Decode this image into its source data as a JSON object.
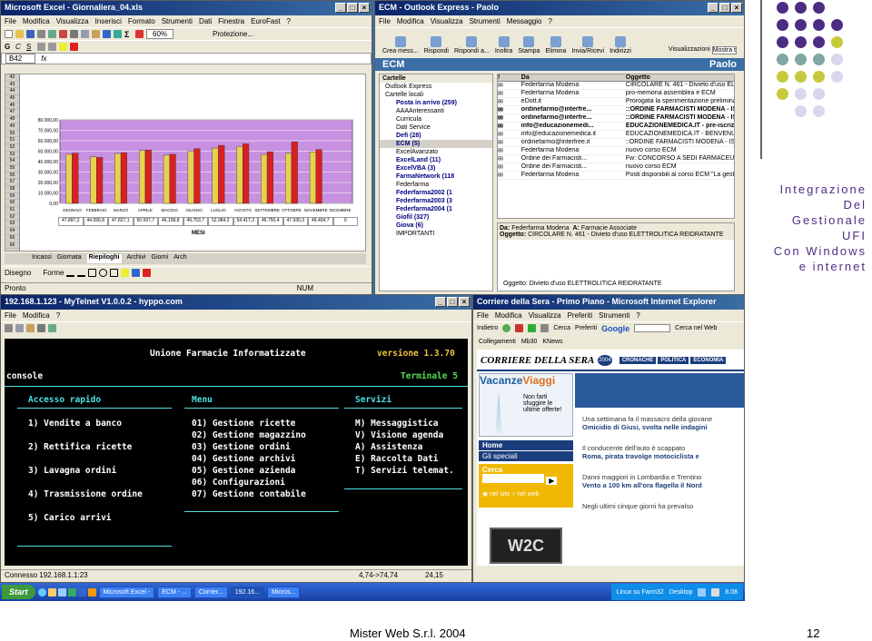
{
  "slide": {
    "title_lines": [
      "Integrazione",
      "Del",
      "Gestionale",
      "UFI",
      "Con Windows",
      "e internet"
    ],
    "footer_left": "Mister Web S.r.l. 2004",
    "footer_right": "12",
    "accent_colors": {
      "purple": "#4b2e83",
      "teal": "#7fa7a4",
      "lime": "#c6c93c",
      "lavender": "#d8d8ec"
    }
  },
  "excel": {
    "title": "Microsoft Excel - Giornaliera_04.xls",
    "menu": [
      "File",
      "Modifica",
      "Visualizza",
      "Inserisci",
      "Formato",
      "Strumenti",
      "Dati",
      "Finestra",
      "EuroFast",
      "?"
    ],
    "zoom": "60%",
    "protection": "Protezione...",
    "cell_ref": "B42",
    "fx": "fx",
    "sheet_tabs": [
      "Incassi",
      "Giornata",
      "Riepiloghi",
      "Archivi",
      "Giorni",
      "Arch"
    ],
    "active_tab": "Riepiloghi",
    "drawing_label": "Disegno",
    "shapes_label": "Forme",
    "status_left": "Pronto",
    "status_right": "NUM",
    "axis_label": "MESI",
    "months": [
      "GENNAIO",
      "FEBBRAIO",
      "MARZO",
      "APRILE",
      "MAGGIO",
      "GIUGNO",
      "LUGLIO",
      "AGOSTO",
      "SETTEMBRE",
      "OTTOBRE",
      "NOVEMBRE",
      "DICEMBRE"
    ],
    "y_ticks": [
      "80.000,00",
      "70.000,00",
      "60.000,00",
      "50.000,00",
      "40.000,00",
      "30.000,00",
      "20.000,00",
      "10.000,00",
      "0,00"
    ],
    "row_values": [
      "47.897,2",
      "44.590,8",
      "47.827,1",
      "50.597,7",
      "46.158,8",
      "49.753,7",
      "52.984,2",
      "54.417,3",
      "46.750,4",
      "47.930,3",
      "49.404,7",
      "0"
    ]
  },
  "chart_data": {
    "type": "bar",
    "categories": [
      "GENNAIO",
      "FEBBRAIO",
      "MARZO",
      "APRILE",
      "MAGGIO",
      "GIUGNO",
      "LUGLIO",
      "AGOSTO",
      "SETTEMBRE",
      "OTTOBRE",
      "NOVEMBRE",
      "DICEMBRE"
    ],
    "series": [
      {
        "values": [
          47000,
          44600,
          47800,
          50600,
          46200,
          49800,
          53000,
          54400,
          46800,
          47900,
          49400,
          0
        ]
      },
      {
        "values": [
          48000,
          44000,
          48500,
          51200,
          47000,
          52300,
          55600,
          57000,
          49500,
          59000,
          51500,
          0
        ]
      }
    ],
    "colors": [
      "#e8d050",
      "#d92020"
    ],
    "xlabel": "MESI",
    "ylim": [
      0,
      80000
    ],
    "background": "#c890e0"
  },
  "outlook": {
    "title": "ECM - Outlook Express - Paolo",
    "menu": [
      "File",
      "Modifica",
      "Visualizza",
      "Strumenti",
      "Messaggio",
      "?"
    ],
    "toolbar": [
      "Crea mess...",
      "Rispondi",
      "Rispondi a...",
      "Inoltra",
      "Stampa",
      "Elimina",
      "Invia/Ricevi",
      "Indirizzi"
    ],
    "view_label": "Visualizzazioni",
    "view_value": "Mostra t",
    "folder_header": "ECM",
    "user_header": "Paolo",
    "folders_caption": "Cartelle",
    "folders": [
      {
        "name": "Outlook Express",
        "bold": false
      },
      {
        "name": "Cartelle locali",
        "bold": false
      },
      {
        "name": "Posta in arrivo (259)",
        "bold": true
      },
      {
        "name": "AAAAnteressanti",
        "bold": false
      },
      {
        "name": "Curricula",
        "bold": false
      },
      {
        "name": "Dati Service",
        "bold": false
      },
      {
        "name": "Defi (28)",
        "bold": true
      },
      {
        "name": "ECM (5)",
        "bold": true
      },
      {
        "name": "ExcelAvanzato",
        "bold": false
      },
      {
        "name": "ExcelLand (11)",
        "bold": true
      },
      {
        "name": "ExcelVBA (3)",
        "bold": true
      },
      {
        "name": "FarmaNetwork (118",
        "bold": true
      },
      {
        "name": "Federfarma",
        "bold": false
      },
      {
        "name": "Federfarma2002 (1",
        "bold": true
      },
      {
        "name": "Federfarma2003 (3",
        "bold": true
      },
      {
        "name": "Federfarma2004 (1",
        "bold": true
      },
      {
        "name": "Giofil (327)",
        "bold": true
      },
      {
        "name": "Giova (6)",
        "bold": true
      },
      {
        "name": "IMPORTANTI",
        "bold": false
      }
    ],
    "columns": {
      "from": "Da",
      "subject": "Oggetto"
    },
    "messages": [
      {
        "from": "Federfarma Modena",
        "subject": "CIRCOLARE N. 461 - Divieto d'uso ELETTRA",
        "bold": false
      },
      {
        "from": "Federfarma Modena",
        "subject": "pro-memoria assemblea e ECM",
        "bold": false
      },
      {
        "from": "eDott.it",
        "subject": "Prorogata la sperimentazione preliminare p",
        "bold": false
      },
      {
        "from": "ordinefarmo@interfre...",
        "subject": "::ORDINE FARMACISTI MODENA - ISCR",
        "bold": true
      },
      {
        "from": "ordinefarmo@interfre...",
        "subject": "::ORDINE FARMACISTI MODENA - ISCR",
        "bold": true
      },
      {
        "from": "info@educazionemedi...",
        "subject": "EDUCAZIONEMEDICA.IT - pre-iscrizio",
        "bold": true
      },
      {
        "from": "info@educazionemedica.it",
        "subject": "EDUCAZIONEMEDICA.IT - BENVENUTO!",
        "bold": false
      },
      {
        "from": "ordinefarmo@interfree.it",
        "subject": "::ORDINE FARMACISTI MODENA - ISCRI",
        "bold": false
      },
      {
        "from": "Federfarma Modena",
        "subject": "nuovo corso ECM",
        "bold": false
      },
      {
        "from": "Ordine dei Farmacisti...",
        "subject": "Fw: CONCORSO A SEDI FARMACEUTICHE",
        "bold": false
      },
      {
        "from": "Ordine dei Farmacisti...",
        "subject": "nuovo corso ECM",
        "bold": false
      },
      {
        "from": "Federfarma Modena",
        "subject": "Posti disponibili al corso ECM \"La gestione",
        "bold": false
      }
    ],
    "preview_from_label": "Da:",
    "preview_from": "Federfarma Modena",
    "preview_to_label": "A:",
    "preview_to": "Farmacie Associate",
    "preview_subject_label": "Oggetto:",
    "preview_subject": "CIRCOLARE N. 461 - Divieto d'uso ELETTROLITICA REIDRATANTE",
    "attachment": "Oggetto: Divieto d'uso ELETTROLITICA REIDRATANTE"
  },
  "terminal": {
    "title": "192.168.1.123 - MyTelnet V1.0.0.2 - hyppo.com",
    "menu": [
      "File",
      "Modifica",
      "?"
    ],
    "header": "Unione Farmacie Informatizzate",
    "version": "versione 1.3.70",
    "console_label": "console",
    "terminal_label": "Terminale 5",
    "sections": {
      "left": "Accesso rapido",
      "middle": "Menu",
      "right": "Servizi"
    },
    "left_items": [
      "1) Vendite a banco",
      "2) Rettifica ricette",
      "3) Lavagna ordini",
      "4) Trasmissione ordine",
      "5) Carico arrivi"
    ],
    "middle_items": [
      "01) Gestione ricette",
      "02) Gestione magazzino",
      "03) Gestione ordini",
      "04) Gestione archivi",
      "05) Gestione azienda",
      "06) Configurazioni",
      "07) Gestione contabile"
    ],
    "right_items": [
      "M) Messaggistica",
      "V) Visione agenda",
      "A) Assistenza",
      "E) Raccolta Dati",
      "T) Servizi telemat."
    ],
    "status_left": "Connesso 192.168.1.1:23",
    "status_mid": "4,74->74,74",
    "status_right": "24,15"
  },
  "browser": {
    "title": "Corriere della Sera - Primo Piano - Microsoft Internet Explorer",
    "menu": [
      "File",
      "Modifica",
      "Visualizza",
      "Preferiti",
      "Strumenti",
      "?"
    ],
    "back": "Indietro",
    "search_label": "Cerca",
    "prefs_label": "Preferiti",
    "google": "Google",
    "search_web": "Cerca nel Web",
    "links": [
      "Collegamenti",
      "Mb30",
      "KNews"
    ],
    "logo": "CORRIERE DELLA SERA",
    "nav": [
      "CRONACHE",
      "POLITICA",
      "ECONOMIA"
    ],
    "year": "2004",
    "vacanze": "Vacanze",
    "viaggi": "Viaggi",
    "promo": "Non farti sfuggire le ultime offerte!",
    "side_links": [
      "Home",
      "Gli speciali"
    ],
    "cerca_box": "Cerca",
    "radio_site": "nel sito",
    "radio_web": "nel web",
    "wrc": "W2C",
    "headlines": [
      {
        "kicker": "Una settimana fa il massacro della giovane",
        "title": "Omicidio di Giusi, svolta nelle indagini"
      },
      {
        "kicker": "Il conducente dell'auto è scappato",
        "title": "Roma, pirata travolge motociclista e"
      },
      {
        "kicker": "Danni maggiori in Lombardia e Trentino",
        "title": "Vento a 100 km all'ora flagella il Nord"
      },
      {
        "kicker": "Negli ultimi cinque giorni ha prevalso",
        "title": ""
      }
    ]
  },
  "taskbar": {
    "start": "Start",
    "tasks": [
      "Microsoft Excel -",
      "ECM - ...",
      "Corrier...",
      "192.16...",
      "Micros..."
    ],
    "active_task": "192.16...",
    "tray_text": "Linux su Farm32",
    "desktop": "Desktop",
    "clock": "8.08"
  }
}
